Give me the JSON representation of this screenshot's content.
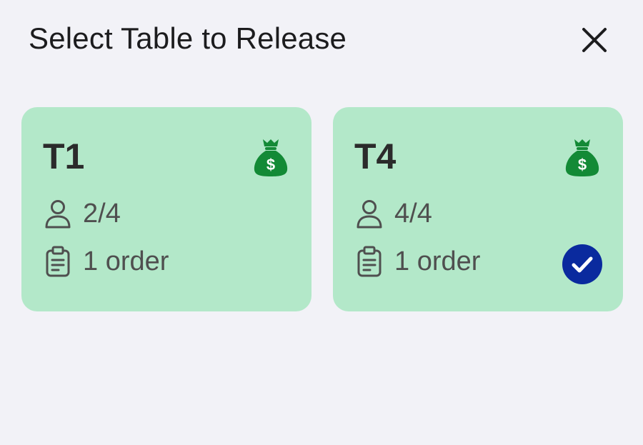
{
  "header": {
    "title": "Select Table to Release",
    "close_icon": "close-icon"
  },
  "tables": [
    {
      "name": "T1",
      "guests": "2/4",
      "orders": "1 order",
      "selected": false,
      "status_icon": "money-bag-icon"
    },
    {
      "name": "T4",
      "guests": "4/4",
      "orders": "1 order",
      "selected": true,
      "status_icon": "money-bag-icon"
    }
  ],
  "colors": {
    "background": "#f2f2f7",
    "card": "#b3e8c9",
    "money_icon": "#138a36",
    "check_badge": "#0a2a9e"
  }
}
